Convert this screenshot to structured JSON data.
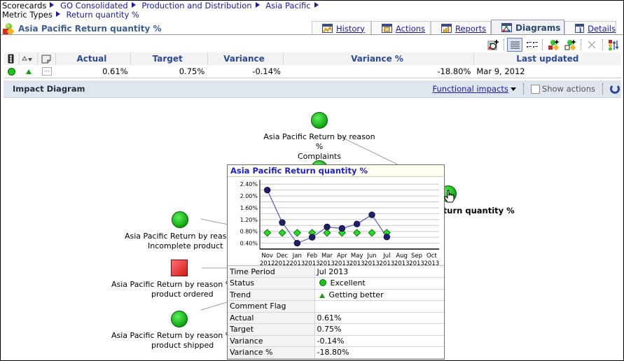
{
  "breadcrumb": {
    "items": [
      {
        "label": "Scorecards",
        "link": false
      },
      {
        "label": "GO Consolidated",
        "link": true
      },
      {
        "label": "Production and Distribution",
        "link": true
      },
      {
        "label": "Asia Pacific",
        "link": true
      }
    ],
    "line2": [
      {
        "label": "Metric Types",
        "link": false
      },
      {
        "label": "Return quantity %",
        "link": true
      }
    ]
  },
  "page_title": "Asia Pacific Return quantity %",
  "tabs": [
    {
      "label": "History",
      "icon": "history-chart-icon",
      "active": false
    },
    {
      "label": "Actions",
      "icon": "actions-icon",
      "active": false
    },
    {
      "label": "Reports",
      "icon": "reports-bar-icon",
      "active": false
    },
    {
      "label": "Diagrams",
      "icon": "diagram-icon",
      "active": true
    },
    {
      "label": "Details",
      "icon": "info-icon",
      "active": false
    }
  ],
  "toolbar": {
    "buttons": [
      "add-impact-icon",
      "list-view-icon",
      "grid-view-icon",
      "add-metric-icon",
      "edit-metric-icon",
      "delete-icon",
      "swap-icon"
    ]
  },
  "metric_table": {
    "headers": {
      "status_icon": "traffic-light-icon",
      "trend_icon": "trend-icon",
      "comment_icon": "comment-icon",
      "actual": "Actual",
      "target": "Target",
      "variance": "Variance",
      "variance_pct": "Variance %",
      "last_updated": "Last updated"
    },
    "row": {
      "status": "Excellent",
      "trend": "Getting better",
      "comment": "...",
      "actual": "0.61%",
      "target": "0.75%",
      "variance": "-0.14%",
      "variance_pct": "-18.80%",
      "last_updated": "Mar 9, 2012"
    }
  },
  "impact_bar": {
    "title": "Impact Diagram",
    "functional_impacts": "Functional impacts",
    "show_actions": "Show actions",
    "show_actions_checked": false
  },
  "diagram": {
    "nodes": [
      {
        "label1": "Asia Pacific Return by reason %",
        "label2": "Complaints",
        "status": "good"
      },
      {
        "label1": "Asia Pacific Return by reason",
        "label2": "Incomplete product",
        "status": "good"
      },
      {
        "label1": "Asia Pacific Return by reason % V",
        "label2": "product ordered",
        "status": "bad"
      },
      {
        "label1": "Asia Pacific Return by reason % V",
        "label2": "product shipped",
        "status": "good"
      }
    ],
    "main_node_label": "eturn quantity %"
  },
  "tooltip": {
    "title": "Asia Pacific Return quantity %",
    "fields": [
      {
        "key": "Time Period",
        "value": "Jul 2013"
      },
      {
        "key": "Status",
        "value": "Excellent",
        "icon": "status-excellent"
      },
      {
        "key": "Trend",
        "value": "Getting better",
        "icon": "trend-up"
      },
      {
        "key": "Comment Flag",
        "value": ""
      },
      {
        "key": "Actual",
        "value": "0.61%"
      },
      {
        "key": "Target",
        "value": "0.75%"
      },
      {
        "key": "Variance",
        "value": "-0.14%"
      },
      {
        "key": "Variance %",
        "value": "-18.80%"
      }
    ]
  },
  "chart_data": {
    "type": "line",
    "title": "",
    "xlabel": "",
    "ylabel": "",
    "categories": [
      "Nov 2012",
      "Dec 2012",
      "Jan 2013",
      "Feb 2013",
      "Mar 2013",
      "Apr 2013",
      "May 2013",
      "Jun 2013",
      "Jul 2013",
      "Aug 2013",
      "Sep 2013",
      "Oct 2013"
    ],
    "x_tick_labels": [
      [
        "Nov",
        "2012"
      ],
      [
        "Dec",
        "2012"
      ],
      [
        "Jan",
        "2013"
      ],
      [
        "Feb",
        "2013"
      ],
      [
        "Mar",
        "2013"
      ],
      [
        "Apr",
        "2013"
      ],
      [
        "May",
        "2013"
      ],
      [
        "Jun",
        "2013"
      ],
      [
        "Jul",
        "2013"
      ],
      [
        "Aug",
        "2013"
      ],
      [
        "Sep",
        "2013"
      ],
      [
        "Oct",
        "2013"
      ]
    ],
    "series": [
      {
        "name": "Actual",
        "color": "#20206a",
        "line_color": "#5a5ab0",
        "marker": "circle",
        "values": [
          2.2,
          1.1,
          0.4,
          0.6,
          0.95,
          0.9,
          1.05,
          1.36,
          0.61,
          null,
          null,
          null
        ]
      },
      {
        "name": "Target",
        "color": "#22dd22",
        "marker": "diamond",
        "line": false,
        "values": [
          0.75,
          0.75,
          0.75,
          0.75,
          0.75,
          0.75,
          0.75,
          0.75,
          0.75,
          null,
          null,
          null
        ]
      }
    ],
    "ylim": [
      0.2,
      2.5
    ],
    "y_ticks": [
      0.4,
      0.8,
      1.2,
      1.6,
      2.0,
      2.4
    ],
    "y_tick_labels": [
      "0.40%",
      "0.80%",
      "1.20%",
      "1.60%",
      "2.00%",
      "2.40%"
    ],
    "gridline_step": 0.2,
    "grid": true,
    "legend": "none"
  }
}
